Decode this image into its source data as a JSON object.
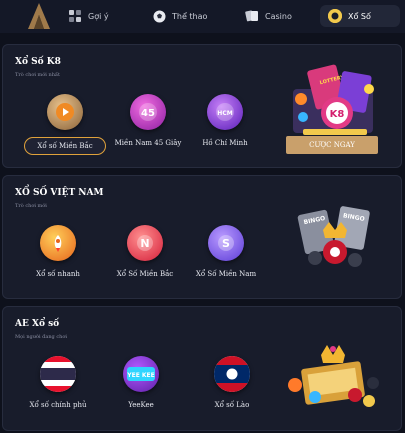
{
  "nav": {
    "tabs": [
      {
        "label": "Gợi ý",
        "icon": "grid-icon"
      },
      {
        "label": "Thể thao",
        "icon": "soccer-ball-icon"
      },
      {
        "label": "Casino",
        "icon": "cards-icon"
      },
      {
        "label": "Xổ Số",
        "icon": "lottery-icon"
      }
    ]
  },
  "sections": [
    {
      "title": "Xổ Số K8",
      "subtitle": "Trò chơi mới nhất",
      "items": [
        {
          "label": "Xổ số Miền Bắc",
          "icon": "play-icon"
        },
        {
          "label": "Miền Nam 45 Giây",
          "icon": "45-icon"
        },
        {
          "label": "Hồ Chí Minh",
          "icon": "hcm-icon"
        }
      ],
      "promo_button": "CƯỢC NGAY"
    },
    {
      "title": "XỔ SỐ VIỆT NAM",
      "subtitle": "Trò chơi mới",
      "items": [
        {
          "label": "Xổ số nhanh",
          "icon": "rocket-icon"
        },
        {
          "label": "Xổ Số Miền Bắc",
          "icon": "n-icon"
        },
        {
          "label": "Xổ Số Miền Nam",
          "icon": "s-icon"
        }
      ]
    },
    {
      "title": "AE Xổ số",
      "subtitle": "Mọi người đang chơi",
      "items": [
        {
          "label": "Xổ số chính phủ",
          "icon": "thai-flag-icon"
        },
        {
          "label": "YeeKee",
          "icon": "yeekee-icon"
        },
        {
          "label": "Xổ số Lào",
          "icon": "laos-flag-icon"
        }
      ]
    }
  ],
  "promo_text": {
    "lottery": "LOTTERY",
    "k8": "K8",
    "bingo": "BINGO"
  },
  "colors": {
    "accent": "#e0a23b",
    "button": "#c9a06b",
    "panel": "#181c2b",
    "background": "#0e111c"
  }
}
